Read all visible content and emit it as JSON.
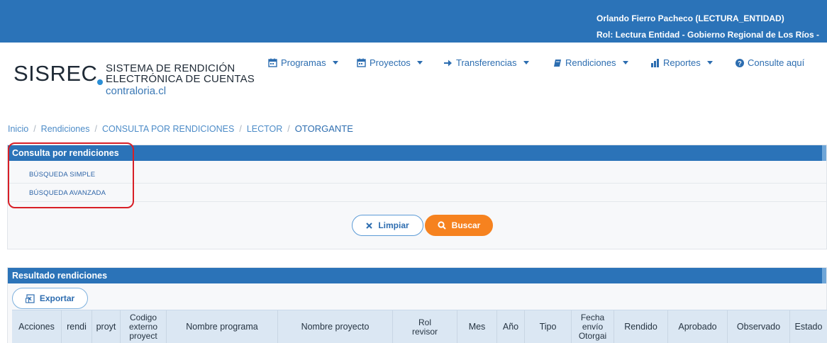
{
  "user": {
    "name": "Orlando Fierro Pacheco (LECTURA_ENTIDAD)",
    "role": "Rol: Lectura Entidad - Gobierno Regional de Los Ríos -"
  },
  "logo": {
    "main": "SISREC",
    "line1": "SISTEMA DE RENDICIÓN",
    "line2": "ELECTRÓNICA DE CUENTAS",
    "line3": "contraloria.cl"
  },
  "nav": {
    "programas": "Programas",
    "proyectos": "Proyectos",
    "transferencias": "Transferencias",
    "rendiciones": "Rendiciones",
    "reportes": "Reportes",
    "consulte": "Consulte aquí"
  },
  "breadcrumb": {
    "inicio": "Inicio",
    "rendiciones": "Rendiciones",
    "consulta": "CONSULTA POR RENDICIONES",
    "lector": "LECTOR",
    "otorgante": "OTORGANTE"
  },
  "search_panel": {
    "title": "Consulta por rendiciones",
    "simple": "BÚSQUEDA SIMPLE",
    "avanzada": "BÚSQUEDA AVANZADA",
    "limpiar": "Limpiar",
    "buscar": "Buscar"
  },
  "results_panel": {
    "title": "Resultado rendiciones",
    "exportar": "Exportar",
    "columns": [
      "Acciones",
      "rendi",
      "proyt",
      "Codigo externo proyect",
      "Nombre programa",
      "Nombre proyecto",
      "Rol revisor",
      "Mes",
      "Año",
      "Tipo",
      "Fecha envío Otorgai",
      "Rendido",
      "Aprobado",
      "Observado",
      "Estado"
    ]
  },
  "colors": {
    "primary": "#2b73b8",
    "accent": "#f6821f",
    "highlight": "#d81f26"
  }
}
